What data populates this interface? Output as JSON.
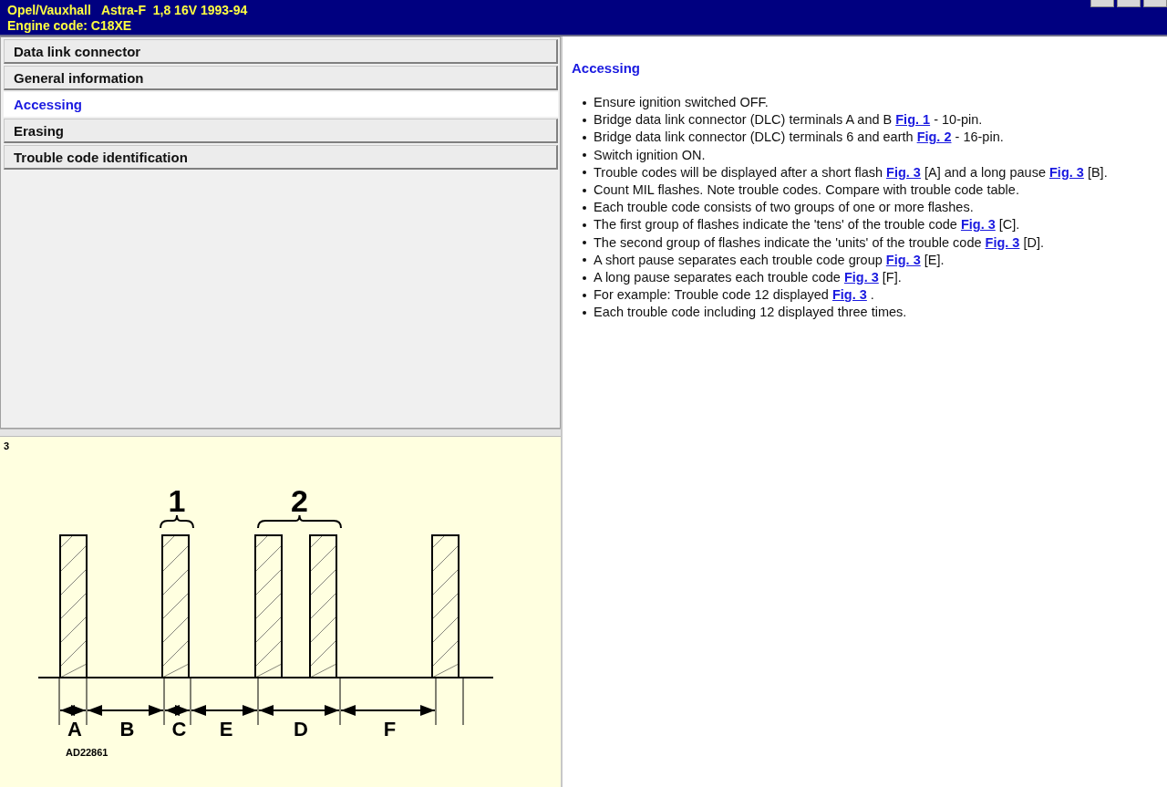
{
  "header": {
    "lines": [
      "Opel/Vauxhall   Astra-F  1,8 16V 1993-94",
      "Engine code: C18XE"
    ]
  },
  "menu": [
    {
      "label": "Data link connector",
      "selected": false
    },
    {
      "label": "General information",
      "selected": false
    },
    {
      "label": "Accessing",
      "selected": true
    },
    {
      "label": "Erasing",
      "selected": false
    },
    {
      "label": "Trouble code identification",
      "selected": false
    }
  ],
  "figure": {
    "number": "3",
    "group_labels": [
      "1",
      "2"
    ],
    "interval_labels": [
      "A",
      "B",
      "C",
      "E",
      "D",
      "F"
    ],
    "code": "AD22861"
  },
  "content": {
    "title": "Accessing",
    "bullets": [
      [
        {
          "kind": "text",
          "text": "Ensure ignition switched OFF."
        }
      ],
      [
        {
          "kind": "text",
          "text": "Bridge data link connector (DLC) terminals A and B "
        },
        {
          "kind": "link",
          "text": "Fig. 1"
        },
        {
          "kind": "text",
          "text": " - 10-pin."
        }
      ],
      [
        {
          "kind": "text",
          "text": "Bridge data link connector (DLC) terminals 6 and earth "
        },
        {
          "kind": "link",
          "text": "Fig. 2"
        },
        {
          "kind": "text",
          "text": " - 16-pin."
        }
      ],
      [
        {
          "kind": "text",
          "text": "Switch ignition ON."
        }
      ],
      [
        {
          "kind": "text",
          "text": "Trouble codes will be displayed after a short flash "
        },
        {
          "kind": "link",
          "text": "Fig. 3"
        },
        {
          "kind": "text",
          "text": " [A] and a long pause "
        },
        {
          "kind": "link",
          "text": "Fig. 3"
        },
        {
          "kind": "text",
          "text": " [B]."
        }
      ],
      [
        {
          "kind": "text",
          "text": "Count MIL flashes. Note trouble codes. Compare with trouble code table."
        }
      ],
      [
        {
          "kind": "text",
          "text": "Each trouble code consists of two groups of one or more flashes."
        }
      ],
      [
        {
          "kind": "text",
          "text": "The first group of flashes indicate the 'tens' of the trouble code "
        },
        {
          "kind": "link",
          "text": "Fig. 3"
        },
        {
          "kind": "text",
          "text": " [C]."
        }
      ],
      [
        {
          "kind": "text",
          "text": "The second group of flashes indicate the 'units' of the trouble code "
        },
        {
          "kind": "link",
          "text": "Fig. 3"
        },
        {
          "kind": "text",
          "text": " [D]."
        }
      ],
      [
        {
          "kind": "text",
          "text": "A short pause separates each trouble code group "
        },
        {
          "kind": "link",
          "text": "Fig. 3"
        },
        {
          "kind": "text",
          "text": " [E]."
        }
      ],
      [
        {
          "kind": "text",
          "text": "A long pause separates each trouble code "
        },
        {
          "kind": "link",
          "text": "Fig. 3"
        },
        {
          "kind": "text",
          "text": " [F]."
        }
      ],
      [
        {
          "kind": "text",
          "text": "For example: Trouble code 12 displayed "
        },
        {
          "kind": "link",
          "text": "Fig. 3"
        },
        {
          "kind": "text",
          "text": " ."
        }
      ],
      [
        {
          "kind": "text",
          "text": "Each trouble code including 12 displayed three times."
        }
      ]
    ]
  }
}
